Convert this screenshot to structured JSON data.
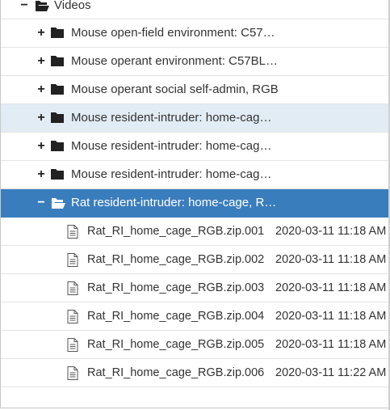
{
  "tree": {
    "root": {
      "label": "Videos",
      "toggle": "−",
      "icon": "folder-open-icon"
    },
    "folders": [
      {
        "label": "Mouse open-field environment: C57…",
        "toggle": "+",
        "state": "collapsed"
      },
      {
        "label": "Mouse operant environment: C57BL…",
        "toggle": "+",
        "state": "collapsed"
      },
      {
        "label": "Mouse operant social self-admin, RGB",
        "toggle": "+",
        "state": "collapsed"
      },
      {
        "label": "Mouse resident-intruder: home-cag…",
        "toggle": "+",
        "state": "hover"
      },
      {
        "label": "Mouse resident-intruder: home-cag…",
        "toggle": "+",
        "state": "collapsed"
      },
      {
        "label": "Mouse resident-intruder: home-cag…",
        "toggle": "+",
        "state": "collapsed"
      }
    ],
    "selected_folder": {
      "label": "Rat resident-intruder: home-cage, R…",
      "toggle": "−",
      "state": "expanded"
    },
    "files": [
      {
        "name": "Rat_RI_home_cage_RGB.zip.001",
        "modified": "2020-03-11 11:18 AM"
      },
      {
        "name": "Rat_RI_home_cage_RGB.zip.002",
        "modified": "2020-03-11 11:18 AM"
      },
      {
        "name": "Rat_RI_home_cage_RGB.zip.003",
        "modified": "2020-03-11 11:18 AM"
      },
      {
        "name": "Rat_RI_home_cage_RGB.zip.004",
        "modified": "2020-03-11 11:18 AM"
      },
      {
        "name": "Rat_RI_home_cage_RGB.zip.005",
        "modified": "2020-03-11 11:18 AM"
      },
      {
        "name": "Rat_RI_home_cage_RGB.zip.006",
        "modified": "2020-03-11 11:22 AM"
      }
    ]
  },
  "colors": {
    "selected": "#3a7dbd",
    "hover": "#e2ecf5",
    "text": "#333333",
    "border": "#e4e4e4"
  }
}
